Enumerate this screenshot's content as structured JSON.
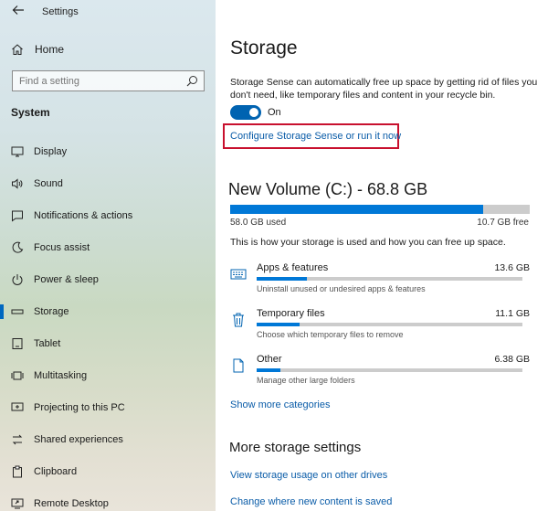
{
  "window": {
    "title": "Settings"
  },
  "sidebar": {
    "home_label": "Home",
    "search_placeholder": "Find a setting",
    "section_title": "System",
    "items": [
      {
        "label": "Display",
        "icon": "display-icon",
        "active": false
      },
      {
        "label": "Sound",
        "icon": "sound-icon",
        "active": false
      },
      {
        "label": "Notifications & actions",
        "icon": "notifications-icon",
        "active": false
      },
      {
        "label": "Focus assist",
        "icon": "focus-assist-icon",
        "active": false
      },
      {
        "label": "Power & sleep",
        "icon": "power-icon",
        "active": false
      },
      {
        "label": "Storage",
        "icon": "storage-icon",
        "active": true
      },
      {
        "label": "Tablet",
        "icon": "tablet-icon",
        "active": false
      },
      {
        "label": "Multitasking",
        "icon": "multitasking-icon",
        "active": false
      },
      {
        "label": "Projecting to this PC",
        "icon": "projecting-icon",
        "active": false
      },
      {
        "label": "Shared experiences",
        "icon": "shared-experiences-icon",
        "active": false
      },
      {
        "label": "Clipboard",
        "icon": "clipboard-icon",
        "active": false
      },
      {
        "label": "Remote Desktop",
        "icon": "remote-desktop-icon",
        "active": false
      }
    ]
  },
  "main": {
    "title": "Storage",
    "description": "Storage Sense can automatically free up space by getting rid of files you don't need, like temporary files and content in your recycle bin.",
    "toggle_state": "On",
    "configure_link": "Configure Storage Sense or run it now",
    "volume": {
      "title": "New Volume (C:) - 68.8 GB",
      "used_label": "58.0 GB used",
      "free_label": "10.7 GB free",
      "used_fraction": 0.843
    },
    "how_text": "This is how your storage is used and how you can free up space.",
    "categories": [
      {
        "name": "Apps & features",
        "size": "13.6 GB",
        "desc": "Uninstall unused or undesired apps & features",
        "icon": "apps-features-icon",
        "fraction": 0.19
      },
      {
        "name": "Temporary files",
        "size": "11.1 GB",
        "desc": "Choose which temporary files to remove",
        "icon": "trash-icon",
        "fraction": 0.16
      },
      {
        "name": "Other",
        "size": "6.38 GB",
        "desc": "Manage other large folders",
        "icon": "other-files-icon",
        "fraction": 0.09
      }
    ],
    "show_more": "Show more categories",
    "more_title": "More storage settings",
    "links": [
      "View storage usage on other drives",
      "Change where new content is saved"
    ]
  },
  "colors": {
    "accent": "#0078d7",
    "highlight_box": "#c8102e",
    "link": "#0a5ca8"
  }
}
